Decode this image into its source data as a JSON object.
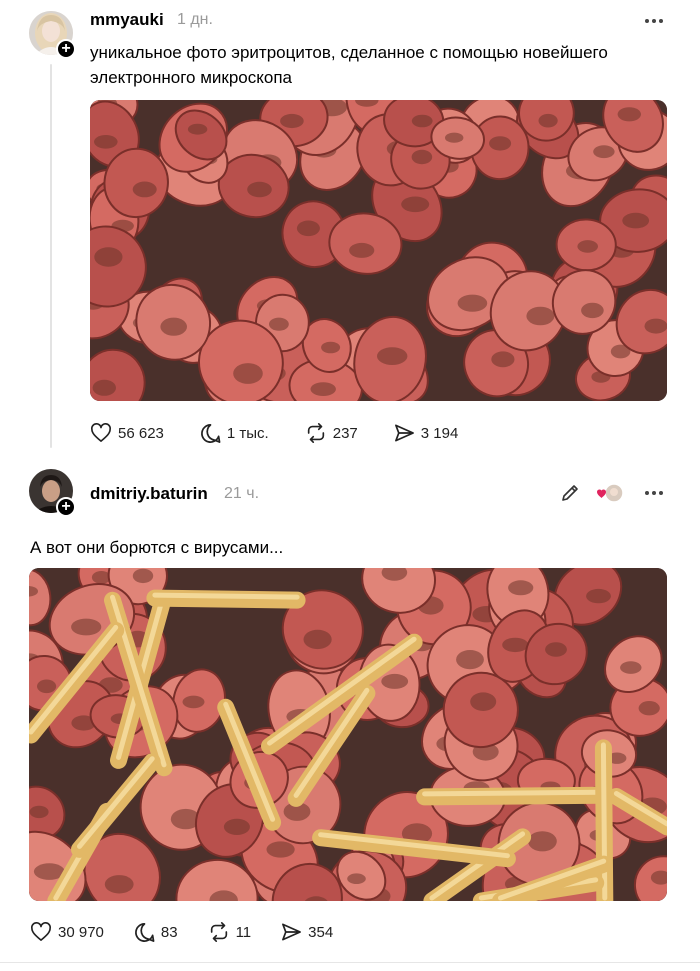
{
  "posts": [
    {
      "username": "mmyauki",
      "time": "1 дн.",
      "text": "уникальное фото эритроцитов, сделанное с помощью новейшего электронного микроскопа",
      "media_alt": "fried sausage slices",
      "stats": {
        "likes": "56 623",
        "replies": "1 тыс.",
        "reposts": "237",
        "shares": "3 194"
      }
    },
    {
      "username": "dmitriy.baturin",
      "time": "21 ч.",
      "text": "А вот они борются с вирусами...",
      "media_alt": "fried sausage slices with french fries",
      "stats": {
        "likes": "30 970",
        "replies": "83",
        "reposts": "11",
        "shares": "354"
      }
    }
  ],
  "icons": {
    "like": "heart-icon",
    "reply": "comment-icon",
    "repost": "repost-icon",
    "share": "share-icon",
    "edit": "pencil-icon",
    "more": "more-icon",
    "follow": "plus-icon"
  },
  "colors": {
    "muted": "#9a9a9a",
    "text": "#000000",
    "divider": "#e6e6e6"
  }
}
